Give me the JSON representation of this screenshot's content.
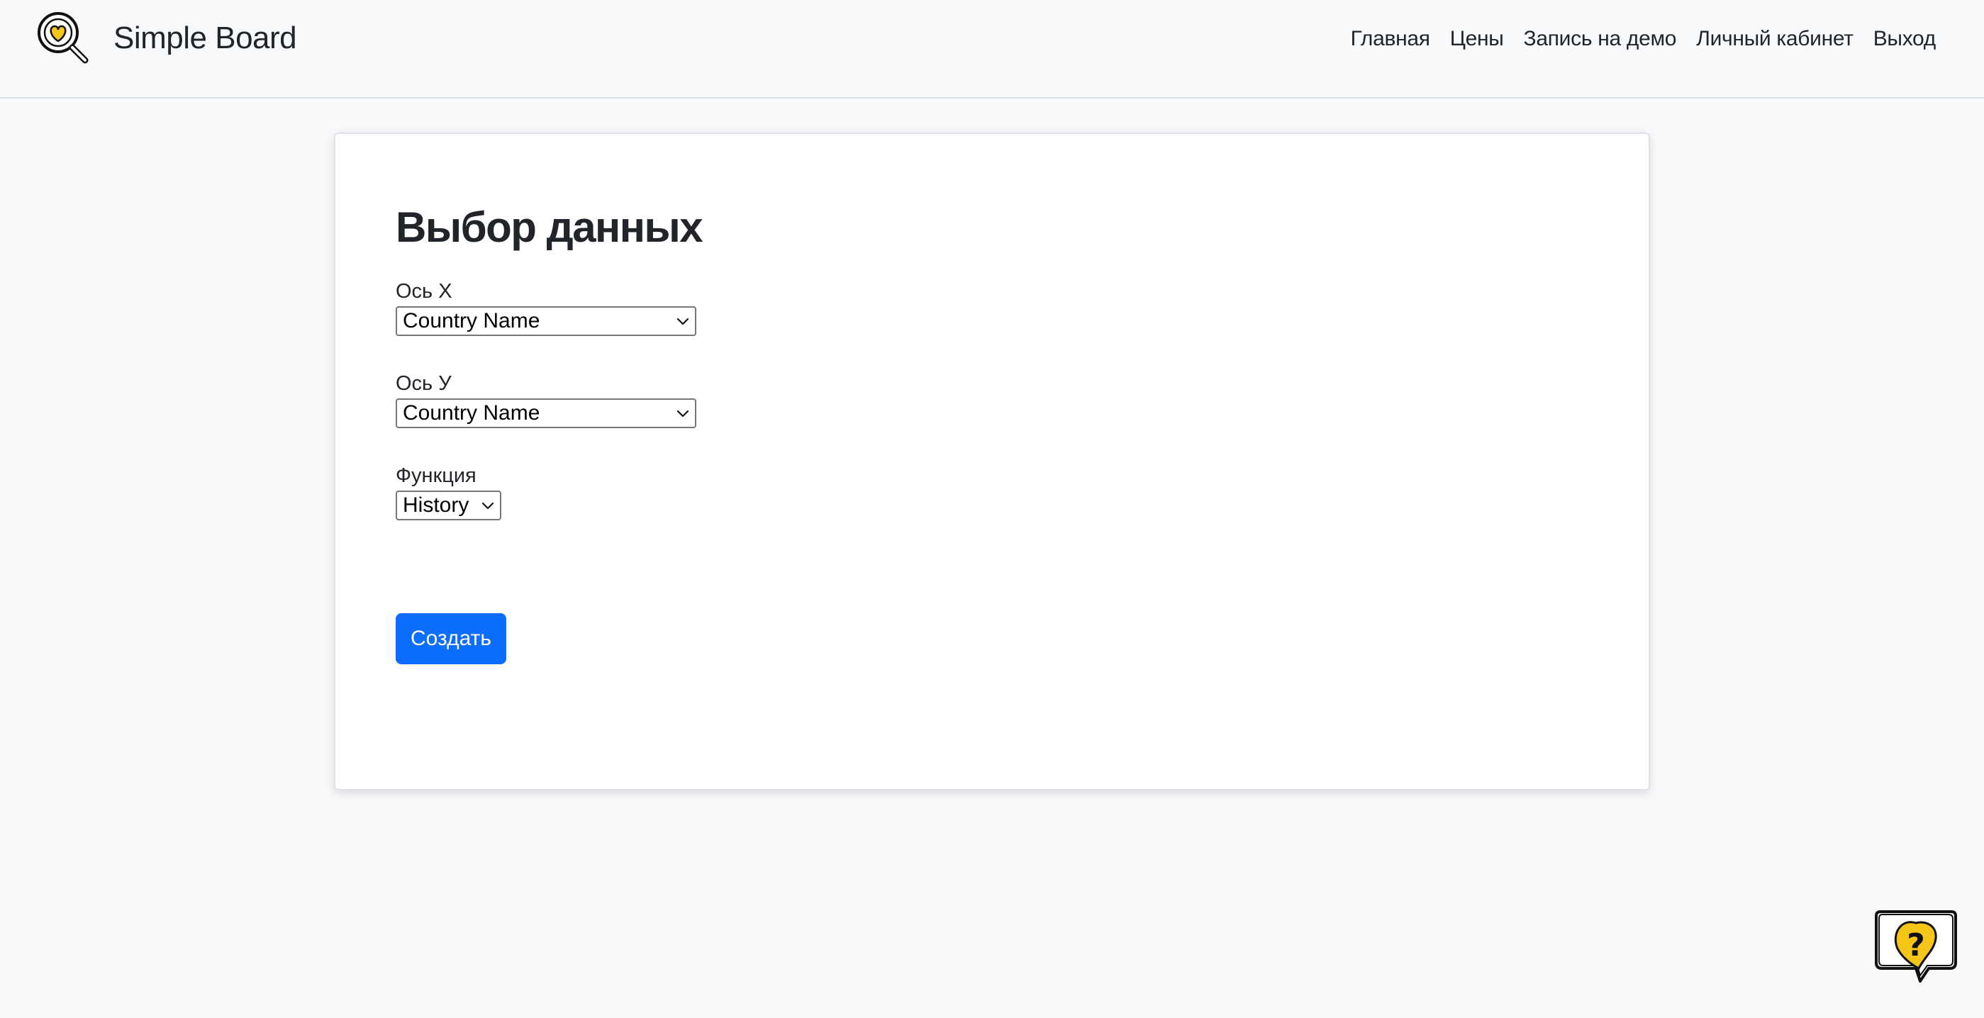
{
  "app": {
    "brand_name": "Simple Board",
    "logo_icon": "magnifier-heart-icon",
    "accent_color": "#0d6efd",
    "logo_color": "#f5c518"
  },
  "nav": {
    "items": [
      {
        "label": "Главная"
      },
      {
        "label": "Цены"
      },
      {
        "label": "Запись на демо"
      },
      {
        "label": "Личный кабинет"
      },
      {
        "label": "Выход"
      }
    ]
  },
  "form": {
    "title": "Выбор данных",
    "x_axis": {
      "label": "Ось X",
      "selected": "Country Name"
    },
    "y_axis": {
      "label": "Ось У",
      "selected": "Country Name"
    },
    "function": {
      "label": "Функция",
      "selected": "History"
    },
    "submit_label": "Создать"
  },
  "help": {
    "icon": "question-bubble-icon"
  }
}
